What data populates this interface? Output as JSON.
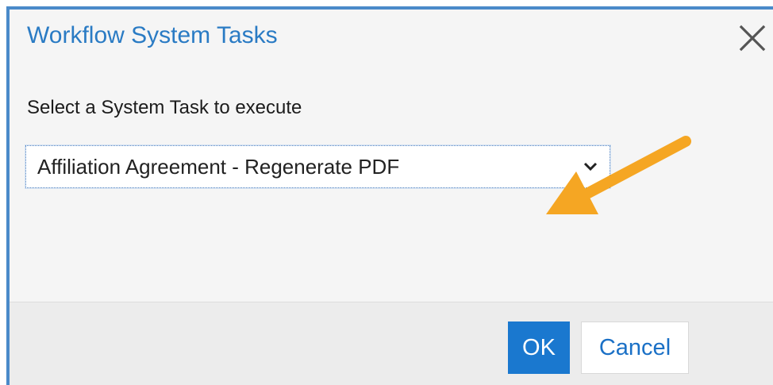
{
  "dialog": {
    "title": "Workflow System Tasks",
    "close_icon": "close-icon"
  },
  "form": {
    "prompt": "Select a System Task to execute",
    "selected_task": "Affiliation Agreement - Regenerate PDF",
    "dropdown_icon": "chevron-down-icon"
  },
  "annotation": {
    "arrow_color": "#f5a623",
    "icon": "pointer-arrow-icon"
  },
  "buttons": {
    "ok_label": "OK",
    "cancel_label": "Cancel"
  },
  "colors": {
    "accent": "#2a7bc4",
    "primary_button": "#1a78cf",
    "border": "#4a8ac9"
  }
}
